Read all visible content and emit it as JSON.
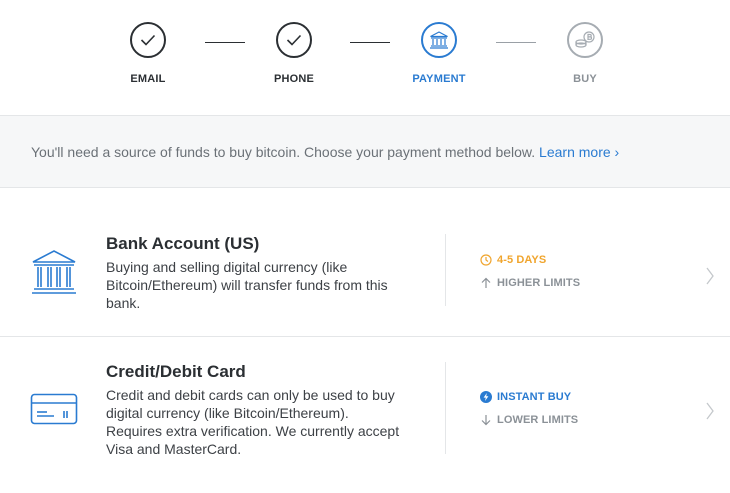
{
  "steps": [
    {
      "label": "EMAIL",
      "state": "complete",
      "icon": "check-icon"
    },
    {
      "label": "PHONE",
      "state": "complete",
      "icon": "check-icon"
    },
    {
      "label": "PAYMENT",
      "state": "active",
      "icon": "bank-icon"
    },
    {
      "label": "BUY",
      "state": "pending",
      "icon": "coins-icon"
    }
  ],
  "notice": {
    "text": "You'll need a source of funds to buy bitcoin. Choose your payment method below.",
    "link": "Learn more ›"
  },
  "methods": [
    {
      "title": "Bank Account (US)",
      "description": "Buying and selling digital currency (like Bitcoin/Ethereum) will transfer funds from this bank.",
      "icon": "bank-icon",
      "meta": [
        {
          "text": "4-5 DAYS",
          "icon": "clock-icon",
          "color": "#f0a52e"
        },
        {
          "text": "HIGHER LIMITS",
          "icon": "arrow-up-icon",
          "color": "#8b9197"
        }
      ]
    },
    {
      "title": "Credit/Debit Card",
      "description": "Credit and debit cards can only be used to buy digital currency (like Bitcoin/Ethereum). Requires extra verification. We currently accept Visa and MasterCard.",
      "icon": "credit-card-icon",
      "meta": [
        {
          "text": "INSTANT BUY",
          "icon": "lightning-icon",
          "color": "#2a7bd1"
        },
        {
          "text": "LOWER LIMITS",
          "icon": "arrow-down-icon",
          "color": "#8b9197"
        }
      ]
    }
  ],
  "colors": {
    "accent": "#2a7bd1",
    "text": "#2b2f33",
    "muted": "#8b9197",
    "warning": "#f0a52e"
  }
}
